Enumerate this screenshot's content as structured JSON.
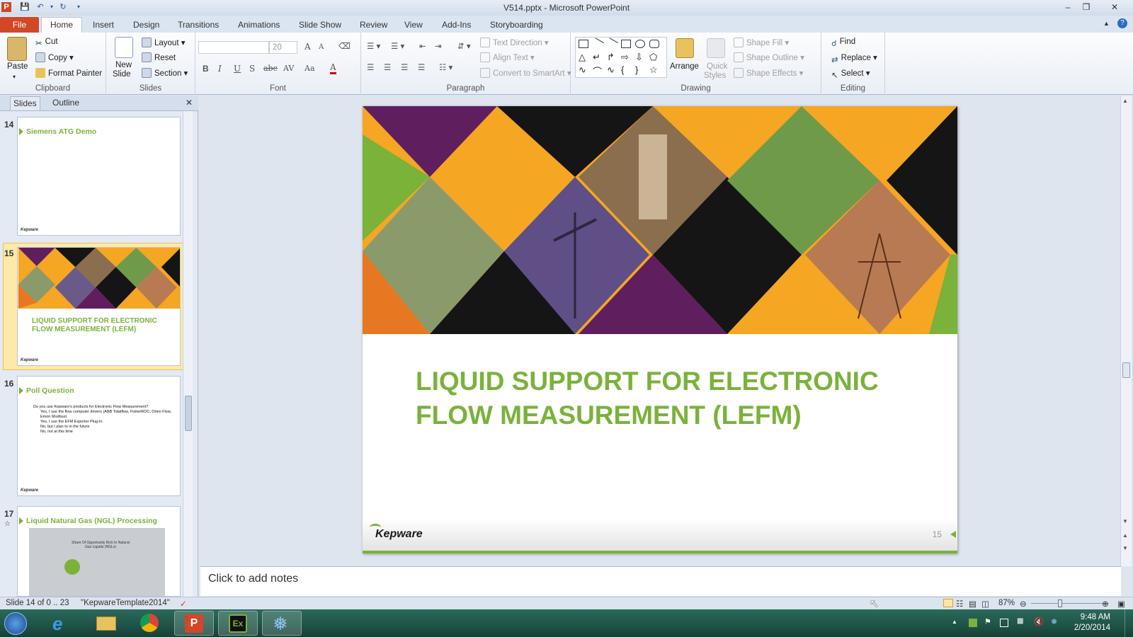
{
  "window": {
    "title": "V514.pptx - Microsoft PowerPoint"
  },
  "tabs": [
    "File",
    "Home",
    "Insert",
    "Design",
    "Transitions",
    "Animations",
    "Slide Show",
    "Review",
    "View",
    "Add-Ins",
    "Storyboarding"
  ],
  "ribbon": {
    "clipboard": {
      "paste": "Paste",
      "cut": "Cut",
      "copy": "Copy",
      "format_painter": "Format Painter",
      "label": "Clipboard"
    },
    "slides": {
      "new_slide_1": "New",
      "new_slide_2": "Slide",
      "layout": "Layout",
      "reset": "Reset",
      "section": "Section",
      "label": "Slides"
    },
    "font": {
      "size": "20",
      "bold": "B",
      "italic": "I",
      "underline": "U",
      "shadow": "S",
      "strike": "abc",
      "spacing": "AV",
      "case": "Aa",
      "color": "A",
      "grow": "A",
      "shrink": "A",
      "label": "Font"
    },
    "paragraph": {
      "text_direction": "Text Direction",
      "align_text": "Align Text",
      "convert_smartart": "Convert to SmartArt",
      "label": "Paragraph"
    },
    "drawing": {
      "arrange": "Arrange",
      "quick_styles_1": "Quick",
      "quick_styles_2": "Styles",
      "shape_fill": "Shape Fill",
      "shape_outline": "Shape Outline",
      "shape_effects": "Shape Effects",
      "label": "Drawing"
    },
    "editing": {
      "find": "Find",
      "replace": "Replace",
      "select": "Select",
      "label": "Editing"
    }
  },
  "panel": {
    "tabs": [
      "Slides",
      "Outline"
    ],
    "thumbs": [
      {
        "num": "14",
        "title": "Siemens ATG Demo",
        "footer": "Kepware"
      },
      {
        "num": "15",
        "title": "LIQUID SUPPORT FOR ELECTRONIC\nFLOW MEASUREMENT (LEFM)",
        "footer": "Kepware"
      },
      {
        "num": "16",
        "title": "Poll Question",
        "footer": "Kepware",
        "bullets": [
          "Do you use Kepware's products for Electronic Flow Measurement?",
          "Yes, I use the flow computer drivers (ABB Totalflow, FisherROC, Omni Flow, Emon Modbus)",
          "Yes, I use the EFM Exporter Plug-In",
          "No, but I plan to in the future",
          "No, not at this time"
        ]
      },
      {
        "num": "17",
        "title": "Liquid Natural Gas (NGL) Processing",
        "map_caption": "Share Of Opportunity Rich In Natural Gas Liquids (NGLs)"
      }
    ]
  },
  "slide": {
    "title": "LIQUID SUPPORT FOR ELECTRONIC\nFLOW MEASUREMENT (LEFM)",
    "number": "15",
    "logo": "Kepware",
    "colors": {
      "green": "#7ab23a",
      "purple": "#5f1f5f",
      "orange": "#f5a623",
      "black": "#151515",
      "dark_orange": "#e87722"
    }
  },
  "notes": {
    "placeholder": "Click to add notes"
  },
  "status": {
    "slide_info": "Slide 14 of 0 .. 23",
    "theme": "\"KepwareTemplate2014\"",
    "zoom": "87%"
  },
  "taskbar": {
    "time": "9:48 AM",
    "date": "2/20/2014"
  }
}
